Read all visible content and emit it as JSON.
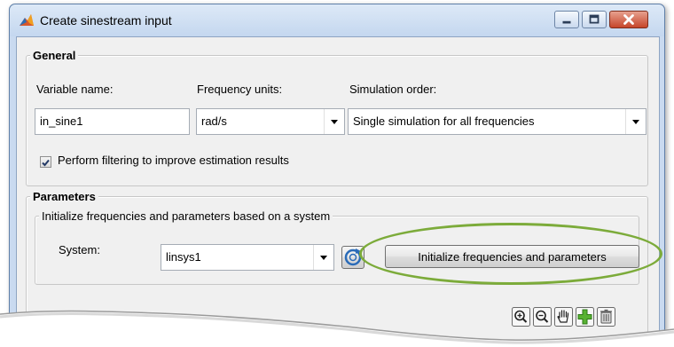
{
  "window": {
    "title": "Create sinestream input",
    "icons": {
      "app": "matlab-logo-icon",
      "minimize": "minimize-icon",
      "maximize": "maximize-icon",
      "close": "close-icon"
    }
  },
  "general": {
    "title": "General",
    "variable_name": {
      "label": "Variable name:",
      "value": "in_sine1"
    },
    "frequency_units": {
      "label": "Frequency units:",
      "selected": "rad/s"
    },
    "simulation_order": {
      "label": "Simulation order:",
      "selected": "Single simulation for all frequencies"
    },
    "filtering": {
      "label": "Perform filtering to improve estimation results",
      "checked": true
    }
  },
  "parameters": {
    "title": "Parameters",
    "init_group": {
      "title": "Initialize frequencies and parameters based on a system",
      "system_label": "System:",
      "system_selected": "linsys1",
      "refresh_icon": "refresh-icon",
      "init_button_label": "Initialize frequencies and parameters"
    },
    "toolbar": [
      "zoom-in-icon",
      "zoom-out-icon",
      "pan-hand-icon",
      "add-icon",
      "delete-icon"
    ]
  },
  "colors": {
    "highlight_ring": "#7cab3a",
    "window_frame": "#c9daf0",
    "close_button": "#c6452a"
  }
}
